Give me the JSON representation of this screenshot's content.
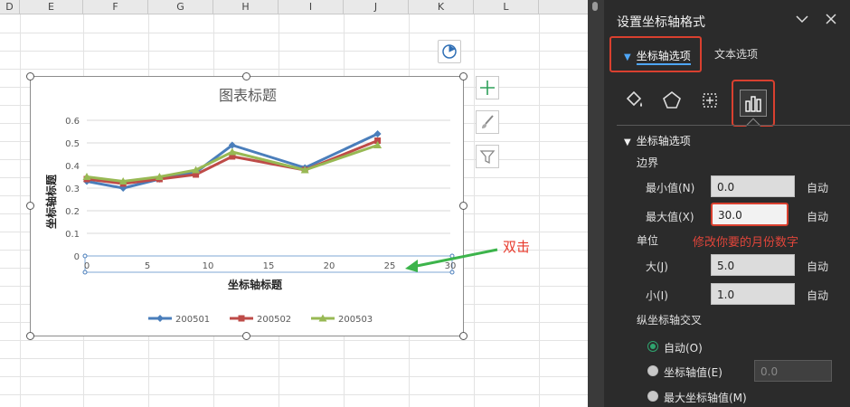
{
  "sheet": {
    "columns": [
      "D",
      "E",
      "F",
      "G",
      "H",
      "I",
      "J",
      "K",
      "L"
    ]
  },
  "chart_data": {
    "type": "line",
    "title": "图表标题",
    "xlabel": "坐标轴标题",
    "ylabel": "坐标轴标题",
    "xlim": [
      0,
      30
    ],
    "ylim": [
      0,
      0.6
    ],
    "x_ticks": [
      "0",
      "5",
      "10",
      "15",
      "20",
      "25",
      "30"
    ],
    "y_ticks": [
      "0",
      "0.1",
      "0.2",
      "0.3",
      "0.4",
      "0.5",
      "0.6"
    ],
    "grid": true,
    "legend_position": "bottom",
    "series": [
      {
        "name": "200501",
        "color": "#4a7ebb",
        "marker": "diamond",
        "x": [
          0,
          3,
          6,
          9,
          12,
          18,
          24
        ],
        "y": [
          0.33,
          0.3,
          0.34,
          0.37,
          0.49,
          0.39,
          0.54
        ]
      },
      {
        "name": "200502",
        "color": "#be4b48",
        "marker": "square",
        "x": [
          0,
          3,
          6,
          9,
          12,
          18,
          24
        ],
        "y": [
          0.34,
          0.32,
          0.34,
          0.36,
          0.44,
          0.38,
          0.51
        ]
      },
      {
        "name": "200503",
        "color": "#98b954",
        "marker": "triangle",
        "x": [
          0,
          3,
          6,
          9,
          12,
          18,
          24
        ],
        "y": [
          0.35,
          0.33,
          0.35,
          0.38,
          0.46,
          0.38,
          0.49
        ]
      }
    ]
  },
  "chart_tools": {
    "layout_icon": "chart-layout-icon",
    "add_icon": "plus-icon",
    "style_icon": "brush-icon",
    "filter_icon": "funnel-icon"
  },
  "annotation": {
    "double_click": "双击"
  },
  "pane": {
    "title": "设置坐标轴格式",
    "tab_axis_options": "坐标轴选项",
    "tab_text_options": "文本选项",
    "section_title": "坐标轴选项",
    "bounds_label": "边界",
    "min_label": "最小值(N)",
    "min_value": "0.0",
    "max_label": "最大值(X)",
    "max_value": "30.0",
    "auto": "自动",
    "annotation": "修改你要的月份数字",
    "units_label": "单位",
    "major_label": "大(J)",
    "major_value": "5.0",
    "minor_label": "小(I)",
    "minor_value": "1.0",
    "cross_label": "纵坐标轴交叉",
    "cross_auto": "自动(O)",
    "cross_value": "坐标轴值(E)",
    "cross_value_input": "0.0",
    "cross_max": "最大坐标轴值(M)"
  },
  "colors": {
    "accent_red": "#d9402f",
    "accent_blue": "#4ea6f7",
    "arrow_green": "#3cb44b",
    "pane_bg": "#2b2b2b"
  }
}
